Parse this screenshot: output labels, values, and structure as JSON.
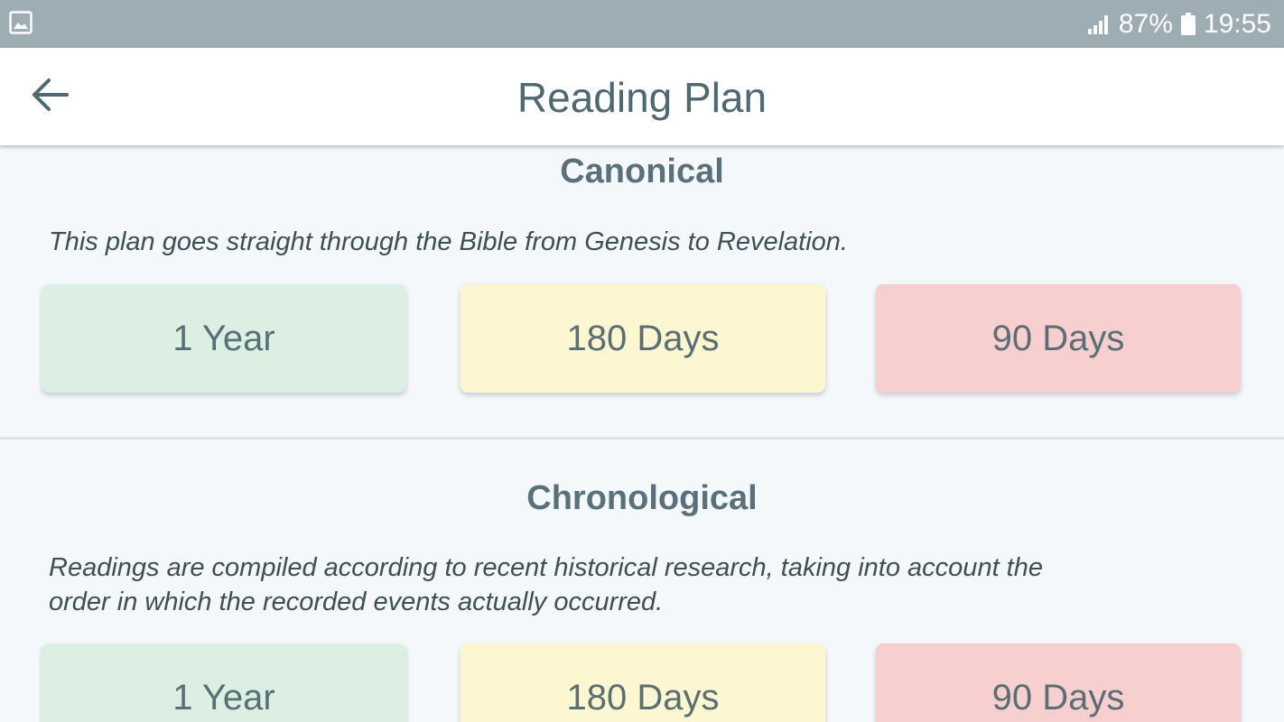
{
  "status_bar": {
    "battery_percent": "87%",
    "time": "19:55",
    "icons": [
      "gallery-notification-icon",
      "signal-icon",
      "battery-icon"
    ]
  },
  "header": {
    "title": "Reading Plan",
    "back_icon": "arrow-left-icon"
  },
  "sections": [
    {
      "title": "Canonical",
      "description": "This plan goes straight through the Bible from Genesis to Revelation.",
      "buttons": [
        {
          "label": "1 Year",
          "color": "#dbefe2"
        },
        {
          "label": "180 Days",
          "color": "#fcf7d1"
        },
        {
          "label": "90 Days",
          "color": "#f8cfcf"
        }
      ]
    },
    {
      "title": "Chronological",
      "description_line1": "Readings are compiled according to recent historical research, taking into account the",
      "description_line2": "order in which the recorded events actually occurred.",
      "buttons": [
        {
          "label": "1 Year",
          "color": "#dbefe2"
        },
        {
          "label": "180 Days",
          "color": "#fcf7d1"
        },
        {
          "label": "90 Days",
          "color": "#f8cfcf"
        }
      ]
    }
  ],
  "colors": {
    "status_bar": "#9eadb3",
    "header_text": "#4f6872",
    "background": "#f4f8fb"
  }
}
